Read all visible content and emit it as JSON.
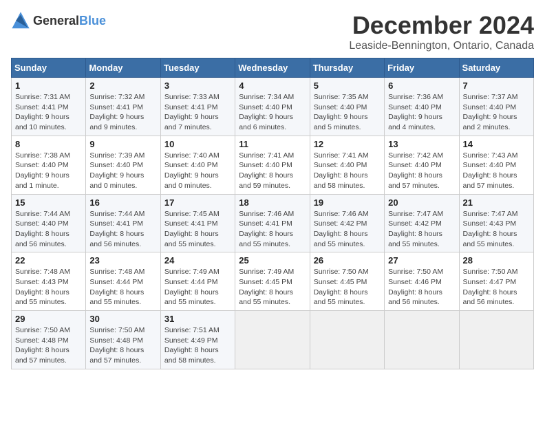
{
  "header": {
    "logo_general": "General",
    "logo_blue": "Blue",
    "month_title": "December 2024",
    "location": "Leaside-Bennington, Ontario, Canada"
  },
  "days_of_week": [
    "Sunday",
    "Monday",
    "Tuesday",
    "Wednesday",
    "Thursday",
    "Friday",
    "Saturday"
  ],
  "weeks": [
    [
      {
        "day": 1,
        "info": "Sunrise: 7:31 AM\nSunset: 4:41 PM\nDaylight: 9 hours\nand 10 minutes."
      },
      {
        "day": 2,
        "info": "Sunrise: 7:32 AM\nSunset: 4:41 PM\nDaylight: 9 hours\nand 9 minutes."
      },
      {
        "day": 3,
        "info": "Sunrise: 7:33 AM\nSunset: 4:41 PM\nDaylight: 9 hours\nand 7 minutes."
      },
      {
        "day": 4,
        "info": "Sunrise: 7:34 AM\nSunset: 4:40 PM\nDaylight: 9 hours\nand 6 minutes."
      },
      {
        "day": 5,
        "info": "Sunrise: 7:35 AM\nSunset: 4:40 PM\nDaylight: 9 hours\nand 5 minutes."
      },
      {
        "day": 6,
        "info": "Sunrise: 7:36 AM\nSunset: 4:40 PM\nDaylight: 9 hours\nand 4 minutes."
      },
      {
        "day": 7,
        "info": "Sunrise: 7:37 AM\nSunset: 4:40 PM\nDaylight: 9 hours\nand 2 minutes."
      }
    ],
    [
      {
        "day": 8,
        "info": "Sunrise: 7:38 AM\nSunset: 4:40 PM\nDaylight: 9 hours\nand 1 minute."
      },
      {
        "day": 9,
        "info": "Sunrise: 7:39 AM\nSunset: 4:40 PM\nDaylight: 9 hours\nand 0 minutes."
      },
      {
        "day": 10,
        "info": "Sunrise: 7:40 AM\nSunset: 4:40 PM\nDaylight: 9 hours\nand 0 minutes."
      },
      {
        "day": 11,
        "info": "Sunrise: 7:41 AM\nSunset: 4:40 PM\nDaylight: 8 hours\nand 59 minutes."
      },
      {
        "day": 12,
        "info": "Sunrise: 7:41 AM\nSunset: 4:40 PM\nDaylight: 8 hours\nand 58 minutes."
      },
      {
        "day": 13,
        "info": "Sunrise: 7:42 AM\nSunset: 4:40 PM\nDaylight: 8 hours\nand 57 minutes."
      },
      {
        "day": 14,
        "info": "Sunrise: 7:43 AM\nSunset: 4:40 PM\nDaylight: 8 hours\nand 57 minutes."
      }
    ],
    [
      {
        "day": 15,
        "info": "Sunrise: 7:44 AM\nSunset: 4:40 PM\nDaylight: 8 hours\nand 56 minutes."
      },
      {
        "day": 16,
        "info": "Sunrise: 7:44 AM\nSunset: 4:41 PM\nDaylight: 8 hours\nand 56 minutes."
      },
      {
        "day": 17,
        "info": "Sunrise: 7:45 AM\nSunset: 4:41 PM\nDaylight: 8 hours\nand 55 minutes."
      },
      {
        "day": 18,
        "info": "Sunrise: 7:46 AM\nSunset: 4:41 PM\nDaylight: 8 hours\nand 55 minutes."
      },
      {
        "day": 19,
        "info": "Sunrise: 7:46 AM\nSunset: 4:42 PM\nDaylight: 8 hours\nand 55 minutes."
      },
      {
        "day": 20,
        "info": "Sunrise: 7:47 AM\nSunset: 4:42 PM\nDaylight: 8 hours\nand 55 minutes."
      },
      {
        "day": 21,
        "info": "Sunrise: 7:47 AM\nSunset: 4:43 PM\nDaylight: 8 hours\nand 55 minutes."
      }
    ],
    [
      {
        "day": 22,
        "info": "Sunrise: 7:48 AM\nSunset: 4:43 PM\nDaylight: 8 hours\nand 55 minutes."
      },
      {
        "day": 23,
        "info": "Sunrise: 7:48 AM\nSunset: 4:44 PM\nDaylight: 8 hours\nand 55 minutes."
      },
      {
        "day": 24,
        "info": "Sunrise: 7:49 AM\nSunset: 4:44 PM\nDaylight: 8 hours\nand 55 minutes."
      },
      {
        "day": 25,
        "info": "Sunrise: 7:49 AM\nSunset: 4:45 PM\nDaylight: 8 hours\nand 55 minutes."
      },
      {
        "day": 26,
        "info": "Sunrise: 7:50 AM\nSunset: 4:45 PM\nDaylight: 8 hours\nand 55 minutes."
      },
      {
        "day": 27,
        "info": "Sunrise: 7:50 AM\nSunset: 4:46 PM\nDaylight: 8 hours\nand 56 minutes."
      },
      {
        "day": 28,
        "info": "Sunrise: 7:50 AM\nSunset: 4:47 PM\nDaylight: 8 hours\nand 56 minutes."
      }
    ],
    [
      {
        "day": 29,
        "info": "Sunrise: 7:50 AM\nSunset: 4:48 PM\nDaylight: 8 hours\nand 57 minutes."
      },
      {
        "day": 30,
        "info": "Sunrise: 7:50 AM\nSunset: 4:48 PM\nDaylight: 8 hours\nand 57 minutes."
      },
      {
        "day": 31,
        "info": "Sunrise: 7:51 AM\nSunset: 4:49 PM\nDaylight: 8 hours\nand 58 minutes."
      },
      null,
      null,
      null,
      null
    ]
  ]
}
